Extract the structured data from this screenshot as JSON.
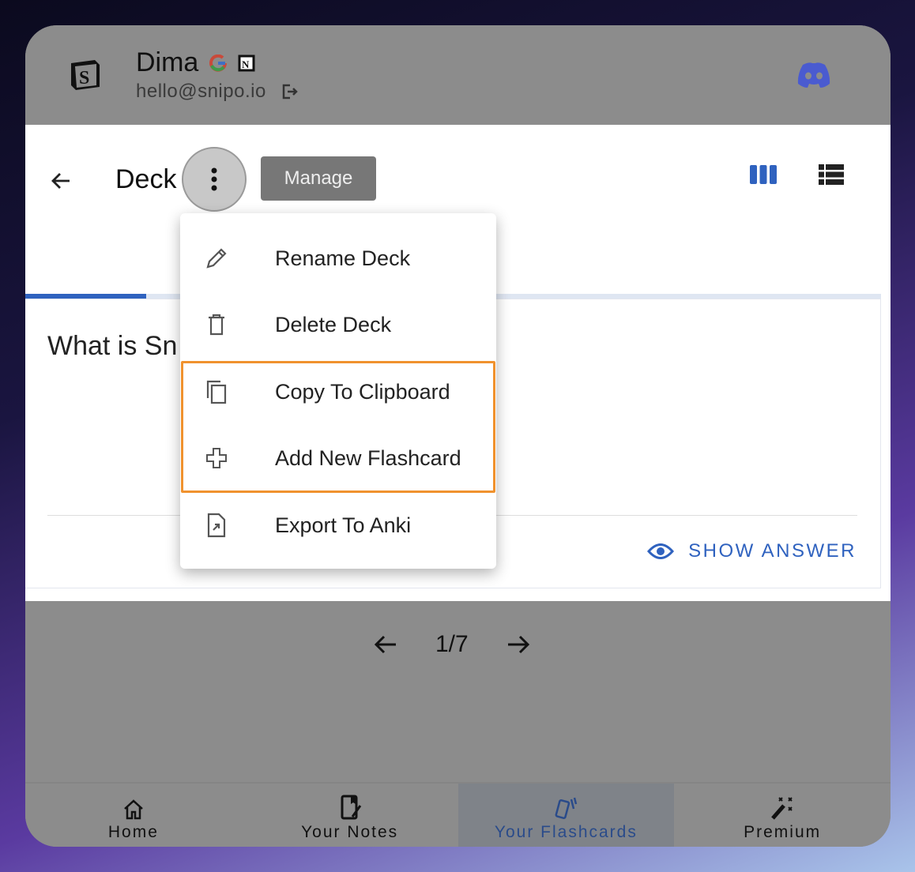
{
  "header": {
    "user_name": "Dima",
    "email": "hello@snipo.io",
    "logo_icon": "snipo-logo-icon",
    "discord_icon": "discord-icon",
    "discord_color": "#4a5bd0"
  },
  "deck": {
    "title": "Deck",
    "manage_label": "Manage",
    "question": "What is Sn",
    "show_answer": "SHOW ANSWER",
    "accent": "#2f62bf"
  },
  "menu": {
    "items": [
      {
        "label": "Rename Deck",
        "icon": "pencil-icon"
      },
      {
        "label": "Delete Deck",
        "icon": "trash-icon"
      },
      {
        "label": "Copy To Clipboard",
        "icon": "copy-icon"
      },
      {
        "label": "Add New Flashcard",
        "icon": "plus-icon"
      },
      {
        "label": "Export To Anki",
        "icon": "file-export-icon"
      }
    ],
    "highlight_color": "#f0922e"
  },
  "pager": {
    "current": "1/7"
  },
  "nav": {
    "items": [
      {
        "label": "Home"
      },
      {
        "label": "Your Notes"
      },
      {
        "label": "Your Flashcards",
        "active": true
      },
      {
        "label": "Premium"
      }
    ]
  }
}
